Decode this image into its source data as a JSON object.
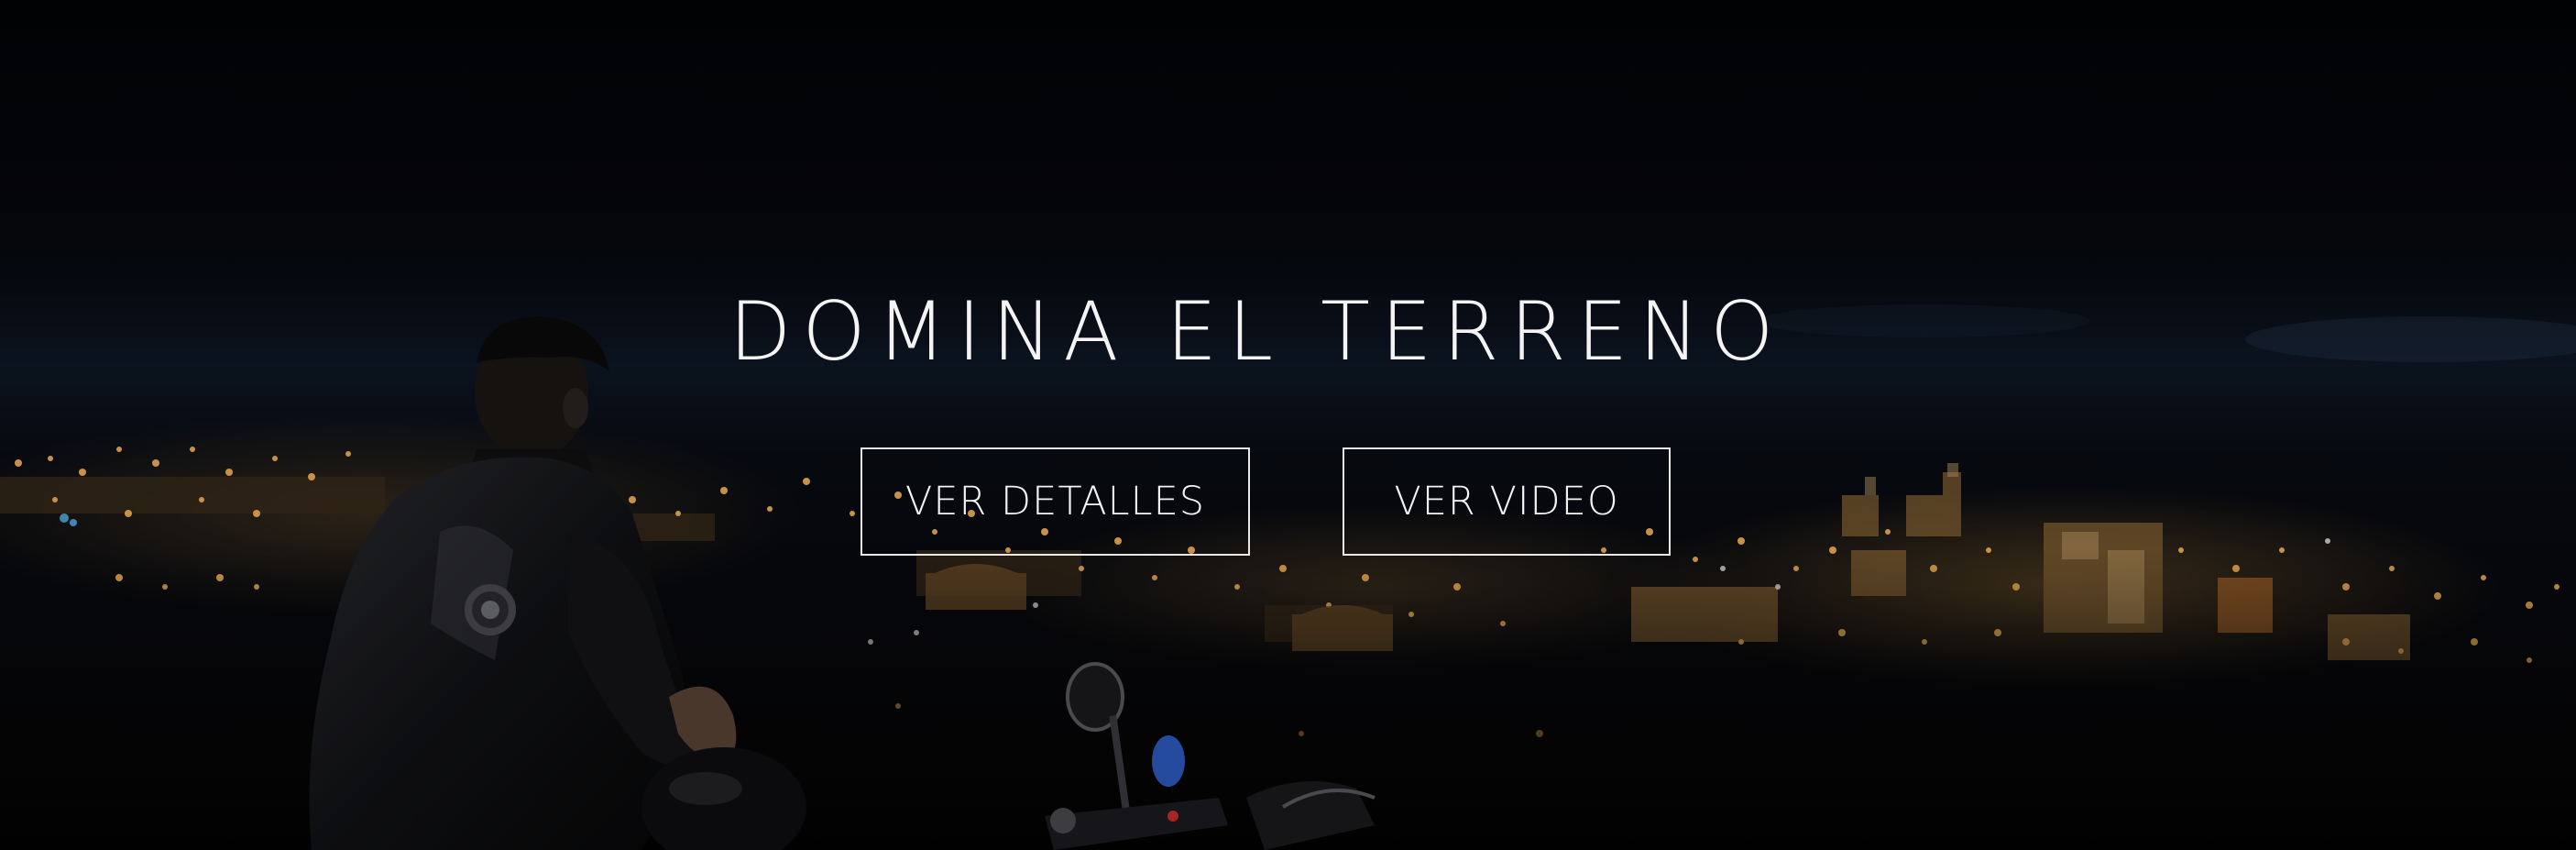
{
  "hero": {
    "title": "DOMINA EL TERRENO",
    "buttons": {
      "details_label": "VER DETALLES",
      "video_label": "VER VIDEO"
    },
    "background": "night city skyline with a motorcyclist in a leather jacket looking out over the lights"
  },
  "colors": {
    "text": "#f4f4f4",
    "button_border": "#e8e8e8",
    "sky": "#030407",
    "city_lights": "#f5b356"
  }
}
